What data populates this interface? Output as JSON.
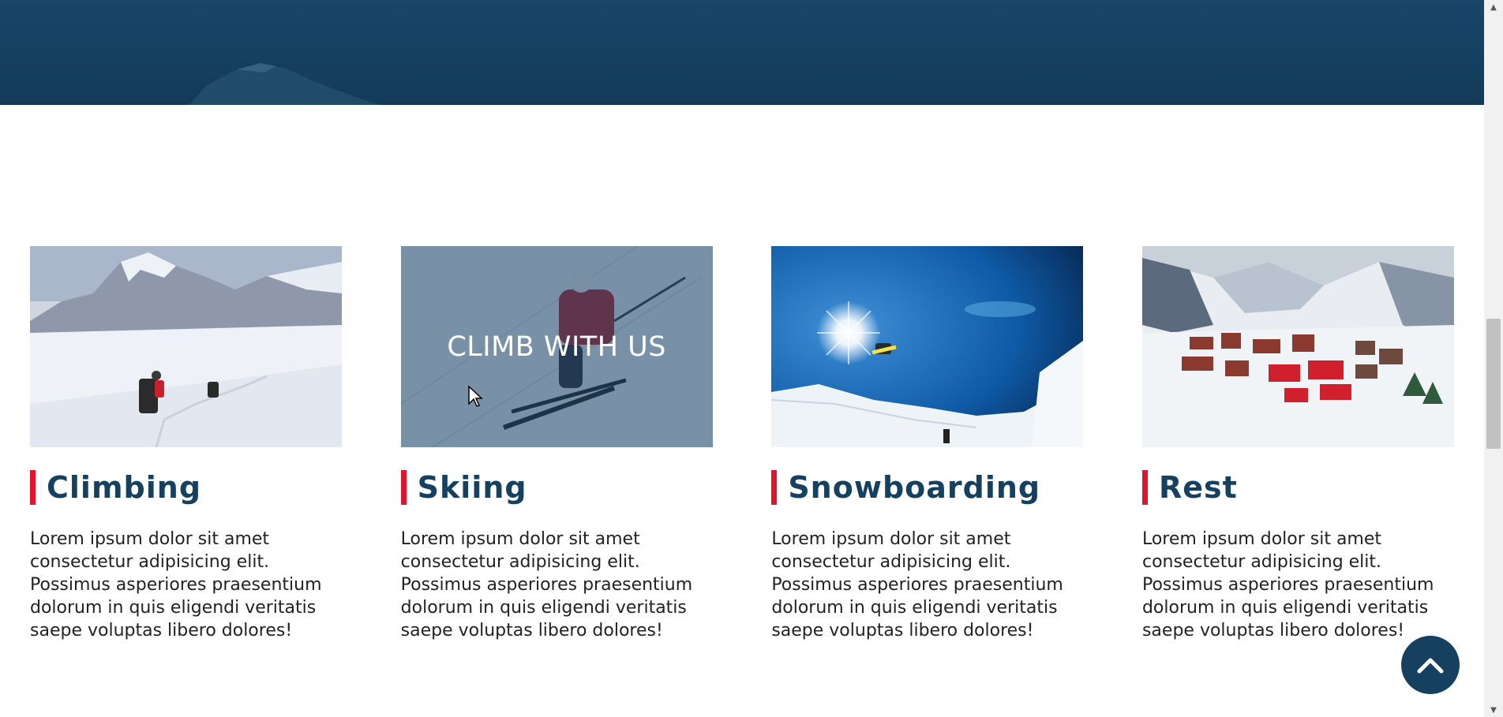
{
  "cards": [
    {
      "title": "Climbing",
      "body": "Lorem ipsum dolor sit amet consectetur adipisicing elit. Possimus asperiores praesentium dolorum in quis eligendi veritatis saepe voluptas libero dolores!"
    },
    {
      "title": "Skiing",
      "overlay_text": "CLIMB WITH US",
      "body": "Lorem ipsum dolor sit amet consectetur adipisicing elit. Possimus asperiores praesentium dolorum in quis eligendi veritatis saepe voluptas libero dolores!"
    },
    {
      "title": "Snowboarding",
      "body": "Lorem ipsum dolor sit amet consectetur adipisicing elit. Possimus asperiores praesentium dolorum in quis eligendi veritatis saepe voluptas libero dolores!"
    },
    {
      "title": "Rest",
      "body": "Lorem ipsum dolor sit amet consectetur adipisicing elit. Possimus asperiores praesentium dolorum in quis eligendi veritatis saepe voluptas libero dolores!"
    }
  ],
  "scroll_top": {
    "icon": "chevron-up-icon"
  },
  "colors": {
    "accent": "#e0142b",
    "title": "#15405f",
    "hero": "#163f5f",
    "button": "#16405f"
  }
}
